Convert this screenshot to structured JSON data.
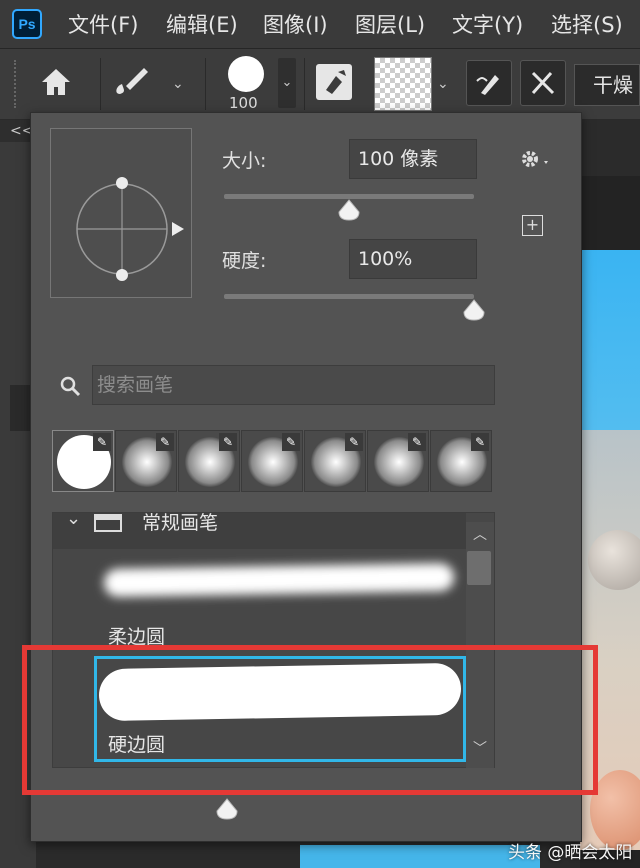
{
  "menu": {
    "logo": "Ps",
    "items": [
      "文件(F)",
      "编辑(E)",
      "图像(I)",
      "图层(L)",
      "文字(Y)",
      "选择(S)"
    ]
  },
  "options_bar": {
    "brush_size_label": "100",
    "mode_label": "干燥",
    "collapse_label": "<<"
  },
  "brush_panel": {
    "size_label": "大小:",
    "size_value": "100 像素",
    "size_fraction": 0.5,
    "hardness_label": "硬度:",
    "hardness_value": "100%",
    "hardness_fraction": 1.0,
    "search_placeholder": "搜索画笔",
    "group_name": "常规画笔",
    "brushes": [
      {
        "name": "柔边圆",
        "selected": false
      },
      {
        "name": "硬边圆",
        "selected": true
      }
    ],
    "preset_count": 7
  },
  "highlight_color": "#e53935",
  "selection_color": "#31b7e8",
  "watermark": "头条 @晒会太阳"
}
